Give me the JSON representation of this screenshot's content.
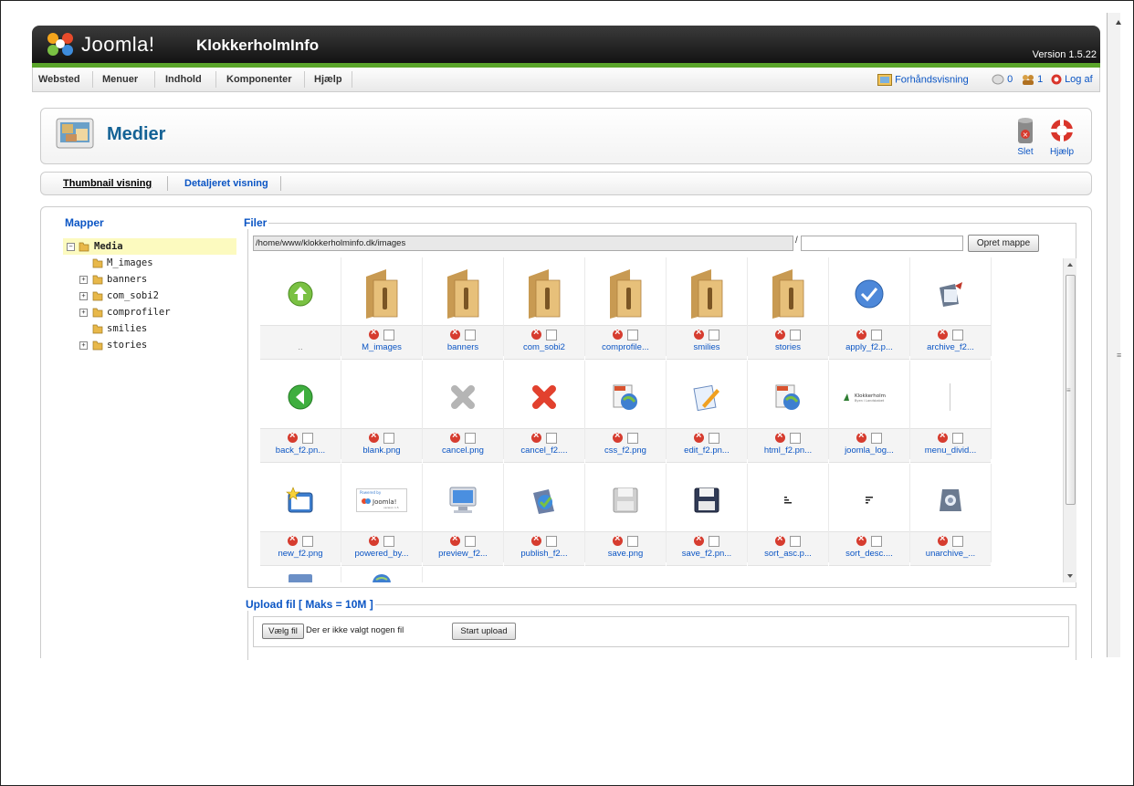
{
  "header": {
    "brand": "Joomla!",
    "site_name": "KlokkerholmInfo",
    "version": "Version 1.5.22"
  },
  "menu": {
    "items": [
      "Websted",
      "Menuer",
      "Indhold",
      "Komponenter",
      "Hjælp"
    ],
    "preview": "Forhåndsvisning",
    "messages_count": "0",
    "users_count": "1",
    "logout": "Log af"
  },
  "toolbar": {
    "title": "Medier",
    "delete_label": "Slet",
    "help_label": "Hjælp"
  },
  "submenu": {
    "thumbnail": "Thumbnail visning",
    "detailed": "Detaljeret visning"
  },
  "folders": {
    "title": "Mapper",
    "root": "Media",
    "items": [
      "M_images",
      "banners",
      "com_sobi2",
      "comprofiler",
      "smilies",
      "stories"
    ]
  },
  "files": {
    "legend": "Filer",
    "path": "/home/www/klokkerholminfo.dk/images",
    "slash": "/",
    "create_folder": "Opret mappe",
    "items": [
      {
        "name": "..",
        "icon": "up-arrow-icon"
      },
      {
        "name": "M_images",
        "icon": "folder-icon"
      },
      {
        "name": "banners",
        "icon": "folder-icon"
      },
      {
        "name": "com_sobi2",
        "icon": "folder-icon"
      },
      {
        "name": "comprofile...",
        "icon": "folder-icon"
      },
      {
        "name": "smilies",
        "icon": "folder-icon"
      },
      {
        "name": "stories",
        "icon": "folder-icon"
      },
      {
        "name": "apply_f2.p...",
        "icon": "apply-icon"
      },
      {
        "name": "archive_f2...",
        "icon": "archive-icon"
      },
      {
        "name": "back_f2.pn...",
        "icon": "back-icon"
      },
      {
        "name": "blank.png",
        "icon": "blank-icon"
      },
      {
        "name": "cancel.png",
        "icon": "cancel-gray-icon"
      },
      {
        "name": "cancel_f2....",
        "icon": "cancel-red-icon"
      },
      {
        "name": "css_f2.png",
        "icon": "css-icon"
      },
      {
        "name": "edit_f2.pn...",
        "icon": "edit-icon"
      },
      {
        "name": "html_f2.pn...",
        "icon": "html-icon"
      },
      {
        "name": "joomla_log...",
        "icon": "klokkerholm-logo-icon"
      },
      {
        "name": "menu_divid...",
        "icon": "menu-divider-icon"
      },
      {
        "name": "new_f2.png",
        "icon": "new-icon"
      },
      {
        "name": "powered_by...",
        "icon": "powered-by-icon"
      },
      {
        "name": "preview_f2...",
        "icon": "preview-icon"
      },
      {
        "name": "publish_f2...",
        "icon": "publish-icon"
      },
      {
        "name": "save.png",
        "icon": "save-gray-icon"
      },
      {
        "name": "save_f2.pn...",
        "icon": "save-icon"
      },
      {
        "name": "sort_asc.p...",
        "icon": "sort-asc-icon"
      },
      {
        "name": "sort_desc....",
        "icon": "sort-desc-icon"
      },
      {
        "name": "unarchive_...",
        "icon": "unarchive-icon"
      },
      {
        "name": "",
        "icon": "partial-icon"
      },
      {
        "name": "",
        "icon": "partial-globe-icon"
      }
    ]
  },
  "upload": {
    "legend": "Upload fil [ Maks = 10M ]",
    "choose": "Vælg fil",
    "no_file": "Der er ikke valgt nogen fil",
    "start": "Start upload"
  },
  "colors": {
    "link": "#0b55c4",
    "title": "#146295",
    "header_green": "#5aa52a",
    "selected": "#fcfabf"
  }
}
